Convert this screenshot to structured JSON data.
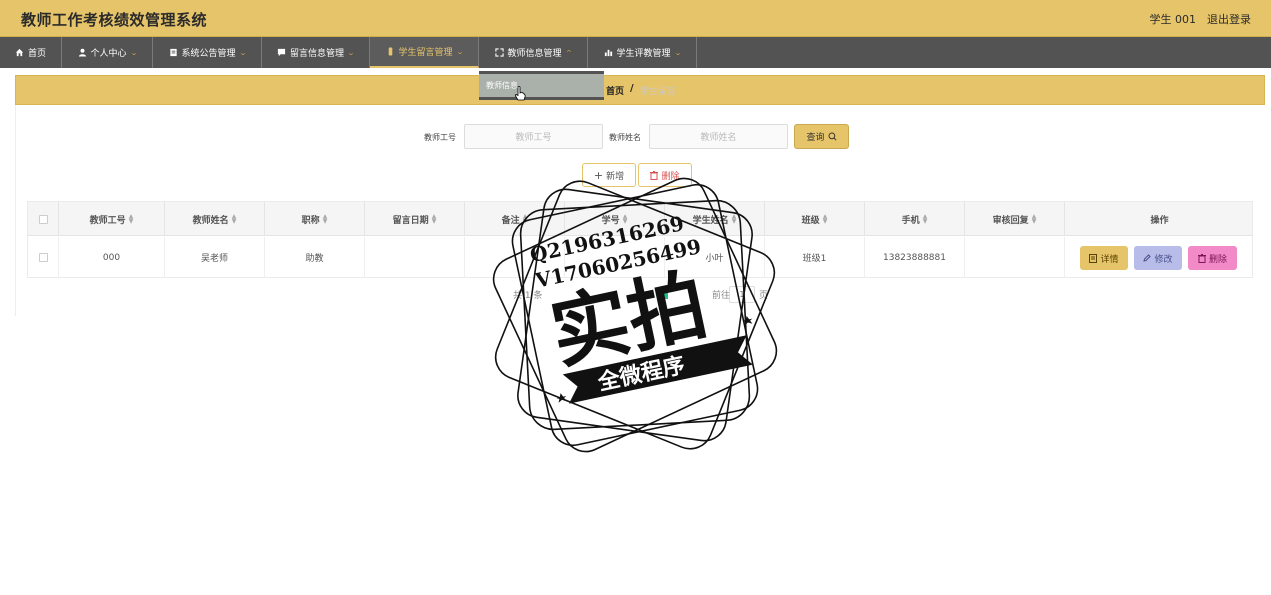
{
  "app": {
    "title": "教师工作考核绩效管理系统",
    "user": "学生 001",
    "logout": "退出登录"
  },
  "nav": [
    {
      "label": "首页",
      "icon": "home-icon"
    },
    {
      "label": "个人中心",
      "icon": "user-icon"
    },
    {
      "label": "系统公告管理",
      "icon": "notice-icon"
    },
    {
      "label": "留言信息管理",
      "icon": "message-icon"
    },
    {
      "label": "学生留言管理",
      "icon": "phone-icon"
    },
    {
      "label": "教师信息管理",
      "icon": "expand-icon"
    },
    {
      "label": "学生评教管理",
      "icon": "bar-chart-icon"
    }
  ],
  "dropdown": {
    "item": "教师信息"
  },
  "breadcrumb": {
    "home": "首页",
    "separator": "/",
    "current": "学生留言"
  },
  "search": {
    "teacher_no_label": "教师工号",
    "teacher_no_placeholder": "教师工号",
    "teacher_name_label": "教师姓名",
    "teacher_name_placeholder": "教师姓名",
    "query_label": "查询"
  },
  "toolbar": {
    "add_label": "新增",
    "delete_label": "删除"
  },
  "table": {
    "columns": [
      "教师工号",
      "教师姓名",
      "职称",
      "留言日期",
      "备注",
      "学号",
      "学生姓名",
      "班级",
      "手机",
      "审核回复",
      "操作"
    ],
    "rows": [
      {
        "teacher_no": "000",
        "teacher_name": "吴老师",
        "title": "助教",
        "date": "",
        "note": "",
        "student_no": "",
        "student_name": "小叶",
        "class": "班级1",
        "phone": "13823888881",
        "reply": ""
      }
    ],
    "actions": {
      "detail": "详情",
      "edit": "修改",
      "delete": "删除"
    }
  },
  "pagination": {
    "total_prefix": "共 1 条",
    "goto": "前往",
    "page": "1",
    "unit": "页"
  },
  "watermark": {
    "line1": "Q2196316269",
    "line2": "V17060256499",
    "main": "实拍",
    "ribbon": "全微程序"
  },
  "colors": {
    "accent": "#e6c46a",
    "nav_bg": "#535353",
    "edit": "#b7bde8",
    "danger": "#f28ac8",
    "page_active": "#1bbf8d"
  }
}
